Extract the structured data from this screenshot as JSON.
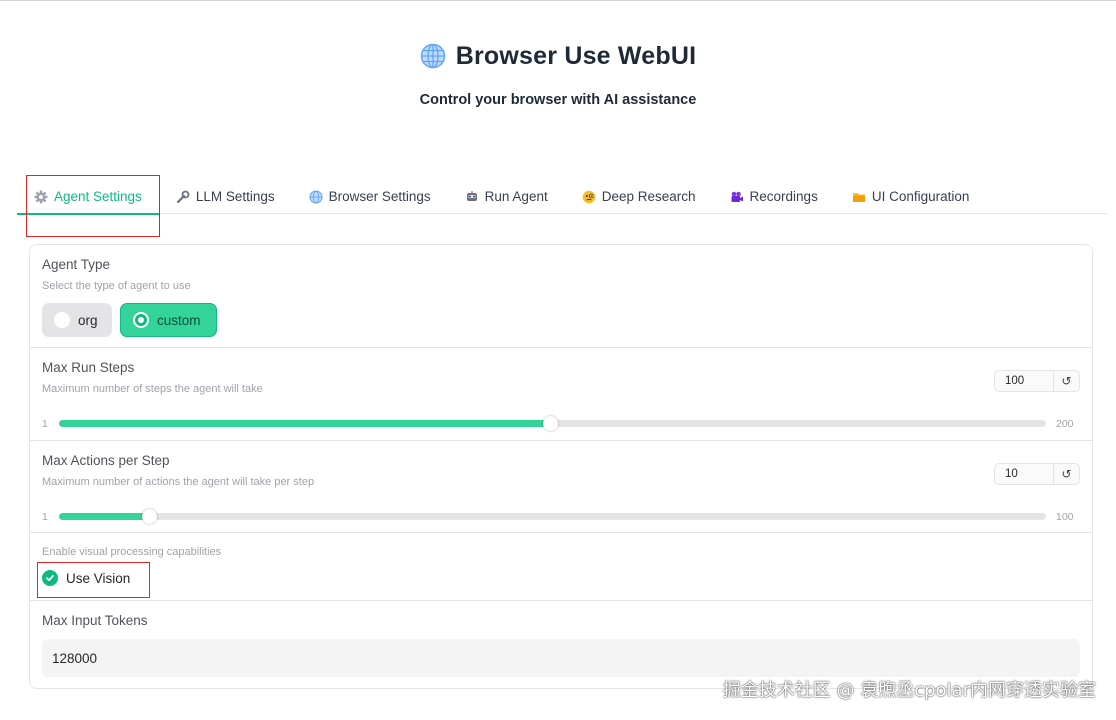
{
  "header": {
    "title": "Browser Use WebUI",
    "subtitle": "Control your browser with AI assistance"
  },
  "tabs": [
    {
      "label": "Agent Settings",
      "icon": "gear-icon",
      "active": true
    },
    {
      "label": "LLM Settings",
      "icon": "wrench-icon",
      "active": false
    },
    {
      "label": "Browser Settings",
      "icon": "globe-icon",
      "active": false
    },
    {
      "label": "Run Agent",
      "icon": "robot-icon",
      "active": false
    },
    {
      "label": "Deep Research",
      "icon": "face-with-monocle-icon",
      "active": false
    },
    {
      "label": "Recordings",
      "icon": "movie-camera-icon",
      "active": false
    },
    {
      "label": "UI Configuration",
      "icon": "folder-icon",
      "active": false
    }
  ],
  "agent_type": {
    "label": "Agent Type",
    "info": "Select the type of agent to use",
    "options": [
      "org",
      "custom"
    ],
    "selected": "custom"
  },
  "max_run_steps": {
    "label": "Max Run Steps",
    "info": "Maximum number of steps the agent will take",
    "value": "100",
    "min": "1",
    "max": "200"
  },
  "max_actions": {
    "label": "Max Actions per Step",
    "info": "Maximum number of actions the agent will take per step",
    "value": "10",
    "min": "1",
    "max": "100"
  },
  "use_vision": {
    "info": "Enable visual processing capabilities",
    "label": "Use Vision",
    "checked": true
  },
  "max_input_tokens": {
    "label": "Max Input Tokens",
    "value": "128000"
  },
  "reset_symbol": "↺",
  "watermark": "掘金技术社区 @ 袁煦丞cpolar内网穿透实验室",
  "colors": {
    "accent": "#10b981",
    "accent_light": "#34d399",
    "highlight_box": "#dc2626"
  }
}
